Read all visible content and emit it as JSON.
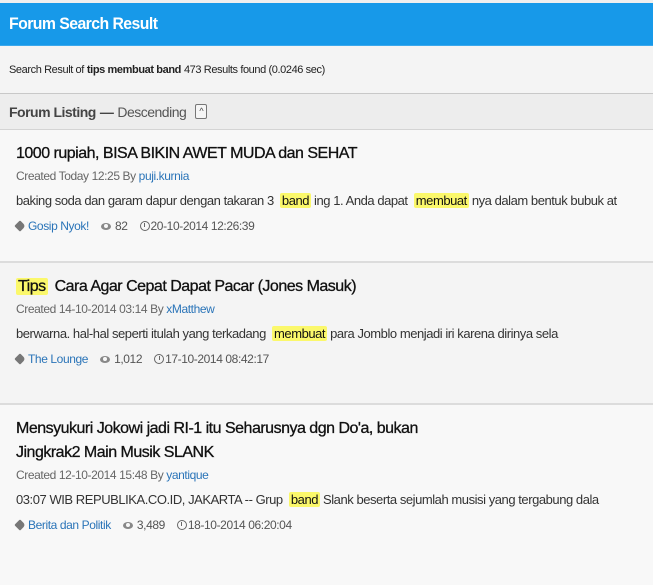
{
  "header": {
    "title": "Forum Search Result"
  },
  "summary": {
    "prefix": "Search Result of",
    "query": "tips membuat band",
    "count_text": "473 Results found (0.0246 sec)"
  },
  "listing": {
    "title": "Forum Listing",
    "dash": "—",
    "order": "Descending",
    "sort_icon": "chevron-up-icon"
  },
  "results": [
    {
      "title_pre": "",
      "title_hl": "",
      "title_post": "1000 rupiah, BISA BIKIN AWET MUDA dan SEHAT",
      "title_line2": "",
      "created_label": "Created Today 12:25 By",
      "author": "puji.kurnia",
      "snippet": {
        "a": "baking soda dan garam dapur dengan takaran 3",
        "hl1": "band",
        "b": "ing 1. Anda dapat",
        "hl2": "membuat",
        "c": "nya dalam bentuk bubuk at"
      },
      "forum": "Gosip Nyok!",
      "views": "82",
      "last_post": "20-10-2014 12:26:39"
    },
    {
      "title_pre": "",
      "title_hl": "Tips",
      "title_post": "Cara Agar Cepat Dapat Pacar (Jones Masuk)",
      "title_line2": "",
      "created_label": "Created 14-10-2014 03:14 By",
      "author": "xMatthew",
      "snippet": {
        "a": "berwarna. hal-hal seperti itulah yang terkadang",
        "hl1": "membuat",
        "b": "para Jomblo menjadi iri karena dirinya sela",
        "hl2": "",
        "c": ""
      },
      "forum": "The Lounge",
      "views": "1,012",
      "last_post": "17-10-2014 08:42:17"
    },
    {
      "title_pre": "",
      "title_hl": "",
      "title_post": "Mensyukuri Jokowi jadi RI-1 itu Seharusnya dgn Do'a, bukan",
      "title_line2": "Jingkrak2 Main Musik SLANK",
      "created_label": "Created 12-10-2014 15:48 By",
      "author": "yantique",
      "snippet": {
        "a": "03:07 WIB REPUBLIKA.CO.ID, JAKARTA -- Grup",
        "hl1": "band",
        "b": "Slank beserta sejumlah musisi yang tergabung dala",
        "hl2": "",
        "c": ""
      },
      "forum": "Berita dan Politik",
      "views": "3,489",
      "last_post": "18-10-2014 06:20:04"
    }
  ],
  "colors": {
    "header_bg": "#1799e9",
    "highlight": "#fbf86b",
    "link": "#2a74b8"
  }
}
